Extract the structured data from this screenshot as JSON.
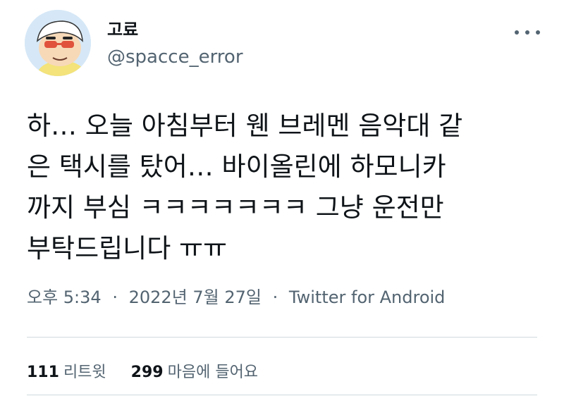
{
  "author": {
    "name": "고료",
    "handle": "@spacce_error"
  },
  "tweet": {
    "text": "하… 오늘 아침부터 웬 브레멘 음악대 같\n은 택시를 탔어… 바이올린에 하모니카\n까지 부심 ㅋㅋㅋㅋㅋㅋㅋ 그냥 운전만\n부탁드립니다 ㅠㅠ",
    "time": "오후 5:34",
    "date": "2022년 7월 27일",
    "separator": "·",
    "source": "Twitter for Android"
  },
  "stats": {
    "retweets_count": "111",
    "retweets_label": "리트윗",
    "likes_count": "299",
    "likes_label": "마음에 들어요"
  },
  "icons": {
    "avatar": "cartoon-boy-avatar",
    "more": "more-dots-icon"
  },
  "colors": {
    "text_primary": "#0f1419",
    "text_secondary": "#536471",
    "divider": "#cfd9de"
  }
}
